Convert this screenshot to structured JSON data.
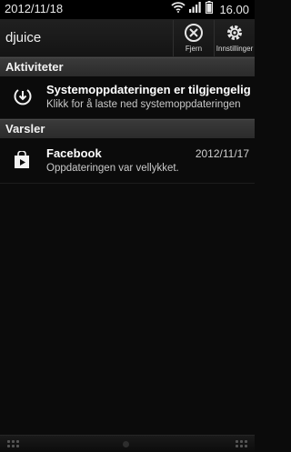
{
  "status_bar": {
    "date": "2012/11/18",
    "time": "16.00",
    "icons": [
      "wifi-icon",
      "signal-icon",
      "battery-icon"
    ]
  },
  "header": {
    "carrier": "djuice",
    "clear_label": "Fjern",
    "settings_label": "Innstillinger"
  },
  "sections": {
    "activities": "Aktiviteter",
    "notices": "Varsler"
  },
  "activity_item": {
    "icon": "download-icon",
    "title": "Systemoppdateringen er tilgjengelig",
    "subtitle": "Klikk for å laste ned systemoppdateringen"
  },
  "notice_item": {
    "icon": "store-icon",
    "title": "Facebook",
    "subtitle": "Oppdateringen var vellykket.",
    "date": "2012/11/17"
  },
  "colors": {
    "background": "#0b0b0b",
    "section_header": "#333333",
    "text": "#ffffff"
  }
}
